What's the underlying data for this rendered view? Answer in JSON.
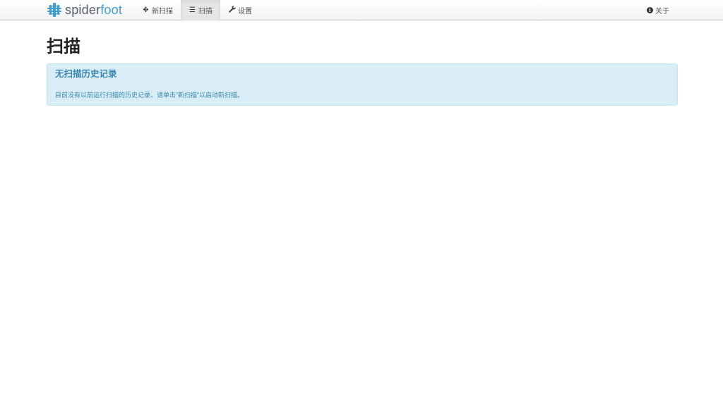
{
  "brand": {
    "name_part1": "spider",
    "name_part2": "foot",
    "logo_icon": "spider-web-logo",
    "colors": {
      "part1": "#56606a",
      "part2": "#3e9ed6"
    }
  },
  "nav": {
    "items": [
      {
        "label": "新扫描",
        "icon": "move-icon",
        "active": false
      },
      {
        "label": "扫描",
        "icon": "list-icon",
        "active": true
      },
      {
        "label": "设置",
        "icon": "wrench-icon",
        "active": false
      }
    ],
    "right": {
      "label": "关于",
      "icon": "info-icon"
    }
  },
  "page": {
    "title": "扫描"
  },
  "alert": {
    "title": "无扫描历史记录",
    "body": "目前没有以前运行扫描的历史记录。请单击“新扫描”以启动新扫描。",
    "colors": {
      "background": "#d9edf7",
      "border": "#bce8f1",
      "text": "#3a87ad"
    }
  }
}
